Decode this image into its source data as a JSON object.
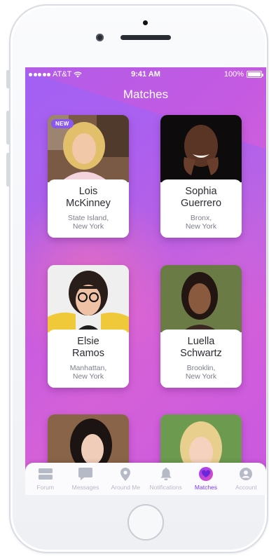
{
  "status_bar": {
    "carrier": "AT&T",
    "time": "9:41 AM",
    "battery": "100%",
    "battery_level": 1.0
  },
  "header": {
    "title": "Matches"
  },
  "badge": {
    "label": "NEW"
  },
  "matches": [
    {
      "name_line1": "Lois",
      "name_line2": "McKinney",
      "loc_line1": "State Island,",
      "loc_line2": "New York",
      "is_new": true
    },
    {
      "name_line1": "Sophia",
      "name_line2": "Guerrero",
      "loc_line1": "Bronx,",
      "loc_line2": "New York",
      "is_new": false
    },
    {
      "name_line1": "Elsie",
      "name_line2": "Ramos",
      "loc_line1": "Manhattan,",
      "loc_line2": "New York",
      "is_new": false
    },
    {
      "name_line1": "Luella",
      "name_line2": "Schwartz",
      "loc_line1": "Brooklin,",
      "loc_line2": "New York",
      "is_new": false
    }
  ],
  "tabbar": {
    "items": [
      {
        "label": "Forum",
        "icon": "forum-icon",
        "active": false
      },
      {
        "label": "Messages",
        "icon": "messages-icon",
        "active": false
      },
      {
        "label": "Around Me",
        "icon": "location-pin-icon",
        "active": false
      },
      {
        "label": "Notifications",
        "icon": "bell-icon",
        "active": false
      },
      {
        "label": "Matches",
        "icon": "heart-icon",
        "active": true
      },
      {
        "label": "Account",
        "icon": "account-icon",
        "active": false
      }
    ]
  },
  "colors": {
    "accent": "#7a3cf0",
    "gradient_start": "#b25ce8",
    "gradient_end": "#d561d8",
    "badge": "#8a57f0",
    "tab_inactive": "#b6bac6"
  }
}
